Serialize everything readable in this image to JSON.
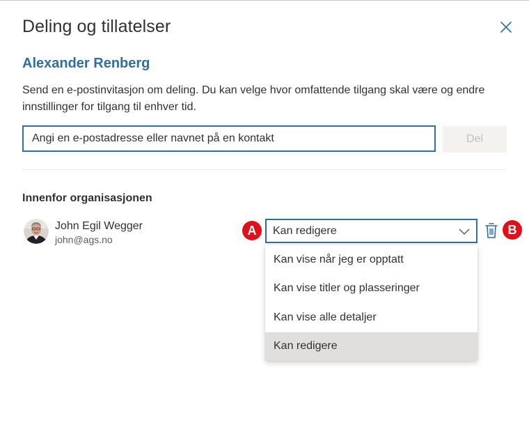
{
  "dialog": {
    "title": "Deling og tillatelser",
    "owner_name": "Alexander Renberg",
    "description": "Send en e-postinvitasjon om deling. Du kan velge hvor omfattende tilgang skal være og endre innstillinger for tilgang til enhver tid."
  },
  "share": {
    "input_placeholder": "Angi en e-postadresse eller navnet på en kontakt",
    "input_value": "",
    "share_button_label": "Del"
  },
  "section": {
    "heading": "Innenfor organisasjonen"
  },
  "person": {
    "name": "John Egil Wegger",
    "email": "john@ags.no"
  },
  "permission": {
    "selected": "Kan redigere",
    "options": [
      "Kan vise når jeg er opptatt",
      "Kan vise titler og plasseringer",
      "Kan vise alle detaljer",
      "Kan redigere"
    ]
  },
  "annotations": {
    "a": "A",
    "b": "B"
  },
  "icons": {
    "close": "close-icon",
    "chevron": "chevron-down-icon",
    "delete": "trash-icon"
  },
  "colors": {
    "accent": "#2f6f9f",
    "badge": "#e0101a",
    "selected_option": "#e1dfdd",
    "disabled_button": "#f3f2f1"
  }
}
